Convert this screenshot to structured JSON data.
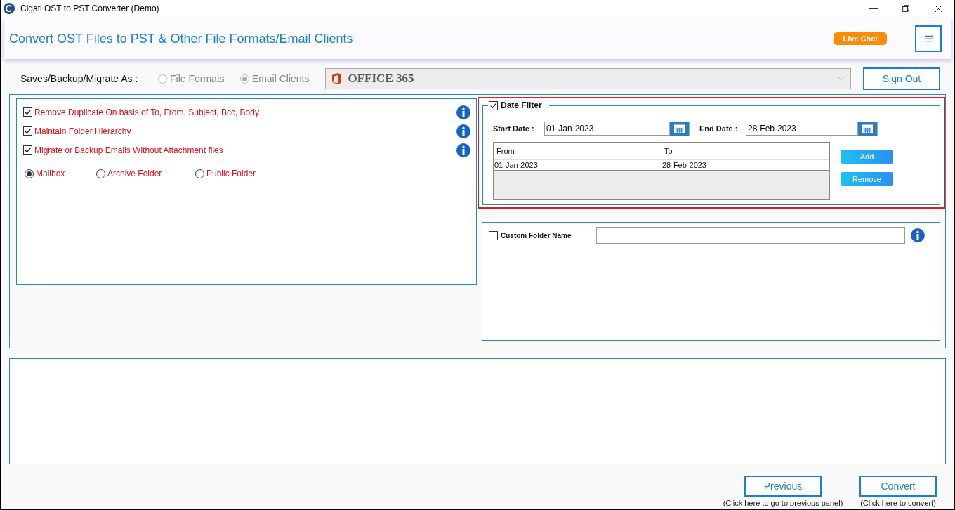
{
  "window": {
    "title": "Cigati OST to PST Converter (Demo)"
  },
  "header": {
    "title": "Convert OST Files to PST & Other File Formats/Email Clients",
    "live_chat": "Live Chat"
  },
  "save_as": {
    "label": "Saves/Backup/Migrate As :",
    "target": "OFFICE 365",
    "sign_out": "Sign Out",
    "options": [
      {
        "label": "File Formats",
        "selected": false
      },
      {
        "label": "Email Clients",
        "selected": true
      }
    ]
  },
  "options": [
    {
      "label": "Remove Duplicate On basis of To, From, Subject, Bcc, Body",
      "checked": true
    },
    {
      "label": "Maintain Folder Hierarchy",
      "checked": true
    },
    {
      "label": "Migrate or Backup Emails Without Attachment files",
      "checked": true
    }
  ],
  "folder_types": [
    {
      "label": "Mailbox",
      "selected": true
    },
    {
      "label": "Archive Folder",
      "selected": false
    },
    {
      "label": "Public Folder",
      "selected": false
    }
  ],
  "date_filter": {
    "label": "Date Filter",
    "checked": true,
    "start_label": "Start Date :",
    "start_value": "01-Jan-2023",
    "end_label": "End Date :",
    "end_value": "28-Feb-2023",
    "columns": [
      "From",
      "To"
    ],
    "rows": [
      [
        "01-Jan-2023",
        "28-Feb-2023"
      ]
    ],
    "buttons": [
      "Add",
      "Remove"
    ]
  },
  "custom_folder": {
    "label": "Custom Folder Name",
    "checked": false
  },
  "footer": {
    "buttons": [
      {
        "label": "Previous",
        "caption": "(Click here to go to previous panel)"
      },
      {
        "label": "Convert",
        "caption": "(Click here to convert)"
      }
    ]
  }
}
